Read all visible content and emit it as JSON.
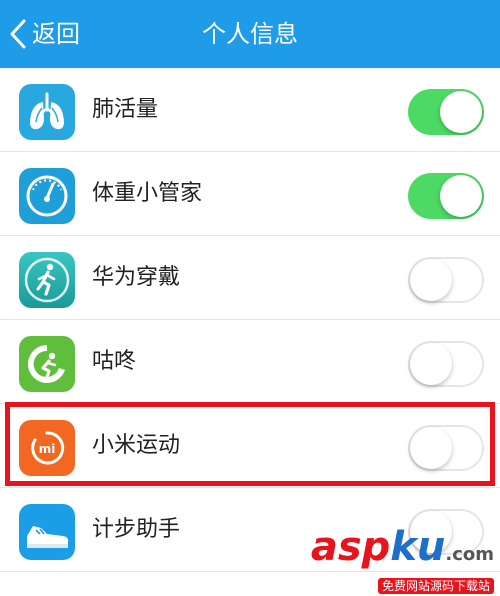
{
  "navbar": {
    "back_label": "返回",
    "title": "个人信息",
    "color": "#1e9ce8"
  },
  "apps": [
    {
      "label": "肺活量",
      "icon": "lungs-icon",
      "enabled": true
    },
    {
      "label": "体重小管家",
      "icon": "weight-gauge-icon",
      "enabled": true
    },
    {
      "label": "华为穿戴",
      "icon": "runner-icon",
      "enabled": false
    },
    {
      "label": "咕咚",
      "icon": "codoon-icon",
      "enabled": false
    },
    {
      "label": "小米运动",
      "icon": "mi-fit-icon",
      "enabled": false
    },
    {
      "label": "计步助手",
      "icon": "sneaker-icon",
      "enabled": false
    }
  ],
  "watermark": {
    "logo_a": "asp",
    "logo_b": "ku",
    "logo_c": ".com",
    "subtitle": "免费网站源码下载站"
  },
  "colors": {
    "toggle_on": "#4cd964",
    "highlight": "#e8141b"
  }
}
